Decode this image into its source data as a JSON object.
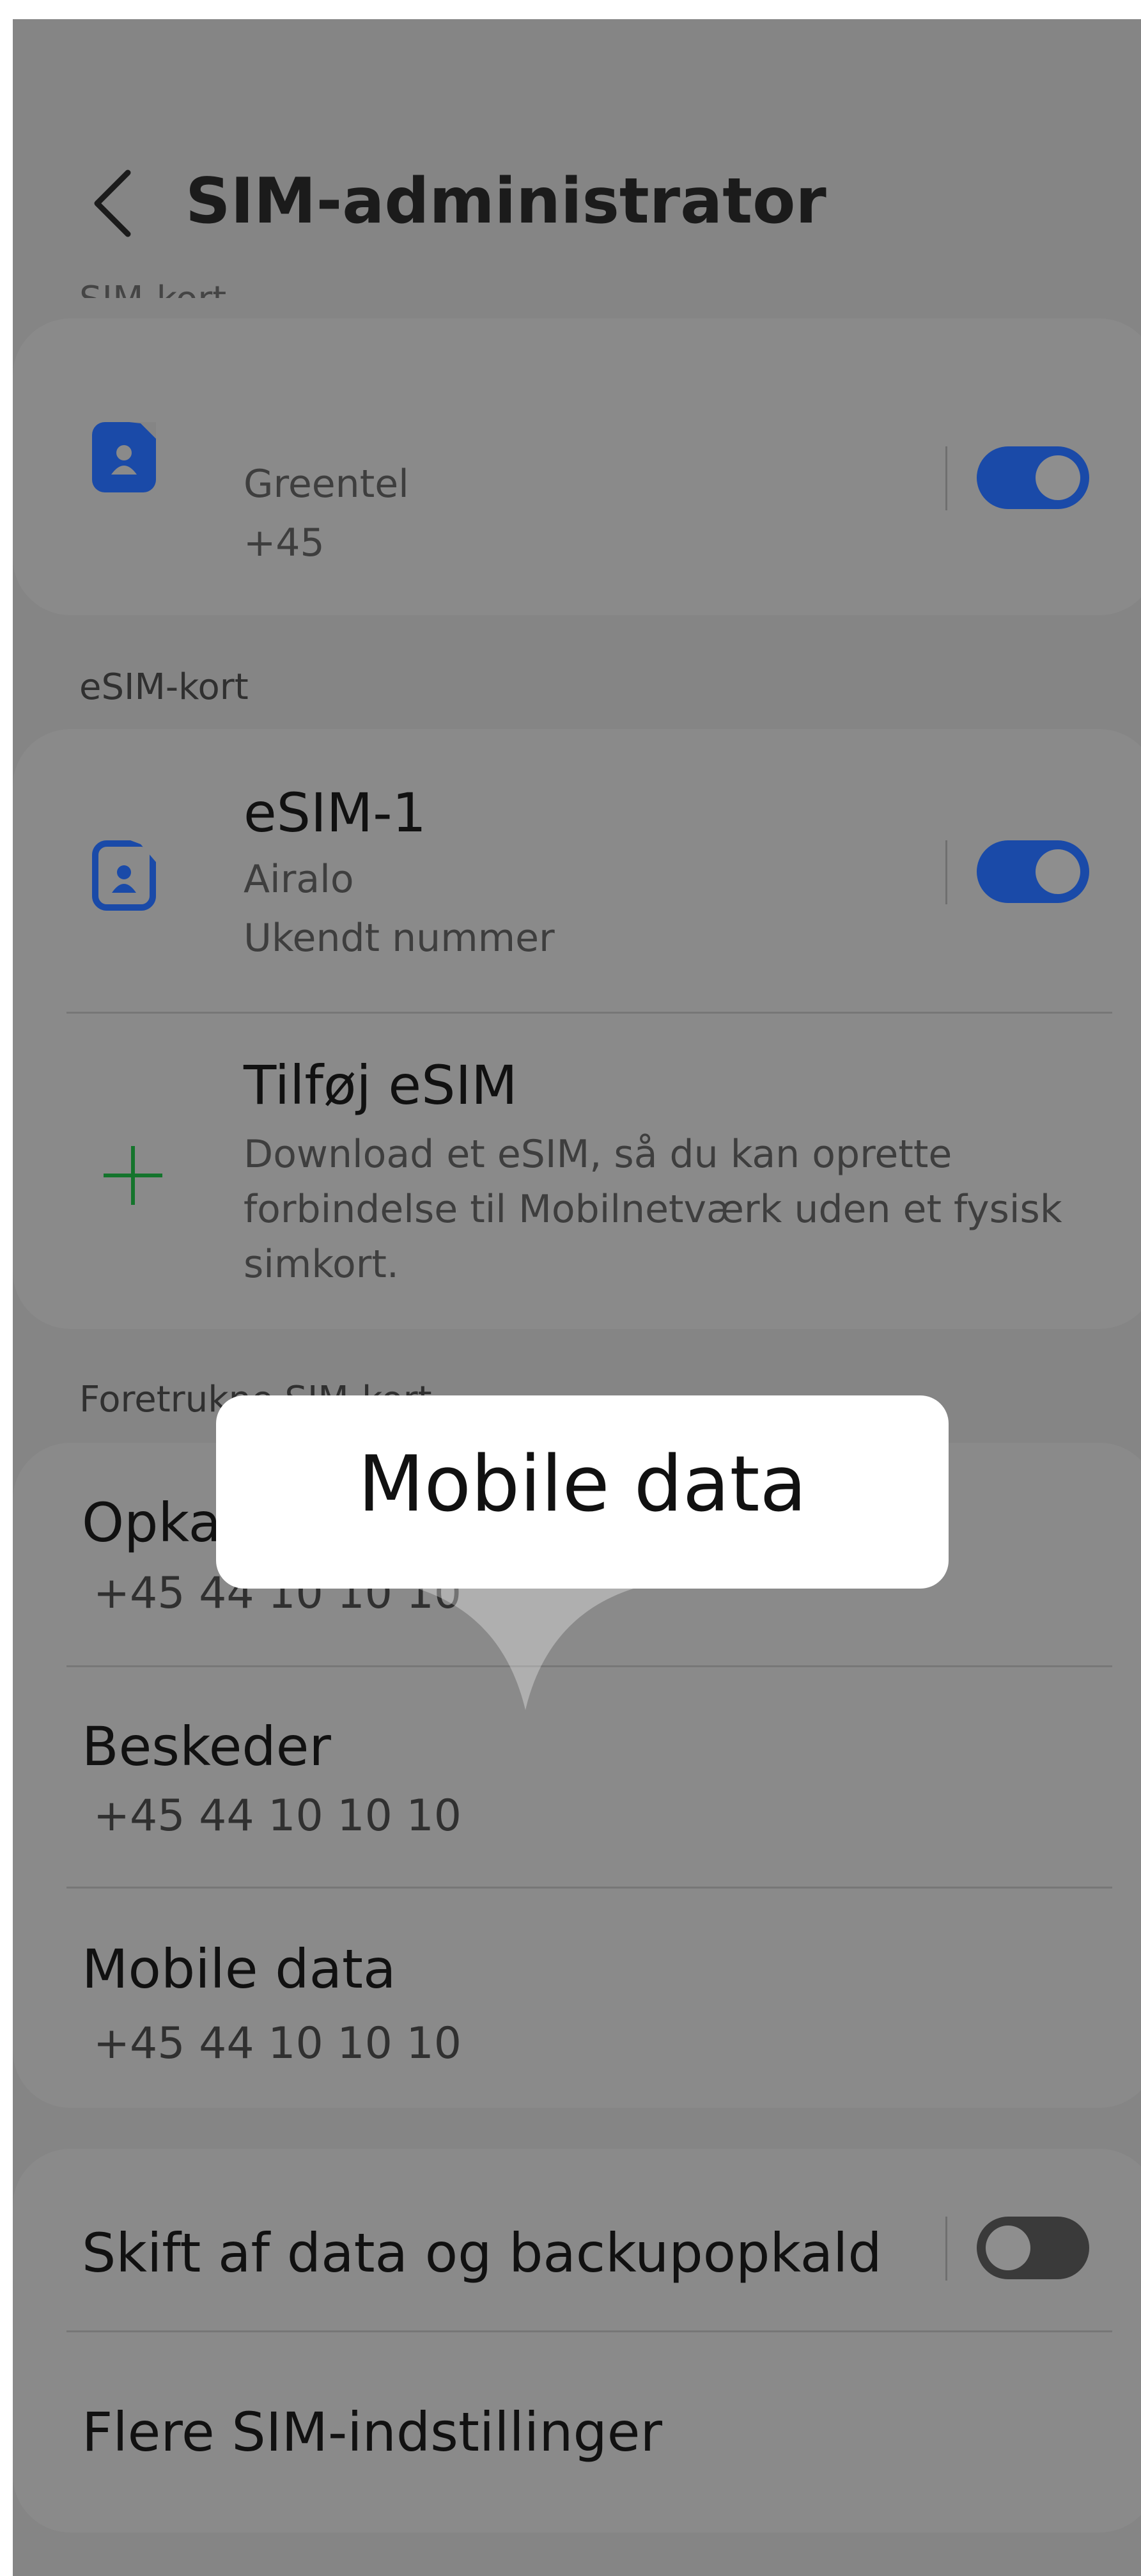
{
  "header": {
    "title": "SIM-administrator",
    "back_icon": "chevron-left-icon"
  },
  "sim_section": {
    "label": "SIM-kort",
    "card": {
      "icon": "sim-card-icon",
      "operator": "Greentel",
      "number": "+45",
      "enabled": true
    }
  },
  "esim_section": {
    "label": "eSIM-kort",
    "esim": {
      "icon": "esim-card-icon",
      "title": "eSIM-1",
      "operator": "Airalo",
      "number": "Ukendt nummer",
      "enabled": true
    },
    "add": {
      "icon": "plus-icon",
      "title": "Tilføj eSIM",
      "description_line1": "Download et eSIM, så du kan oprette",
      "description_line2": "forbindelse til Mobilnetværk uden et fysisk",
      "description_line3": "simkort."
    }
  },
  "preferred_section": {
    "label": "Foretrukne SIM-kort",
    "items": [
      {
        "title": "Opkald",
        "value": "+45 44 10 10 10"
      },
      {
        "title": "Beskeder",
        "value": "+45 44 10 10 10"
      },
      {
        "title": "Mobile data",
        "value": "+45 44 10 10 10"
      }
    ]
  },
  "settings": {
    "switch_label": "Skift af data og backupopkald",
    "switch_enabled": false,
    "more_label": "Flere SIM-indstillinger"
  },
  "tooltip": {
    "text": "Mobile data"
  },
  "colors": {
    "overlay": "#858585",
    "toggle_on": "#1a4aa8",
    "toggle_off": "#3a3a3a",
    "plus_icon": "#14742c",
    "sim_icon": "#1a4aa8",
    "tooltip_bg": "#ffffff"
  }
}
